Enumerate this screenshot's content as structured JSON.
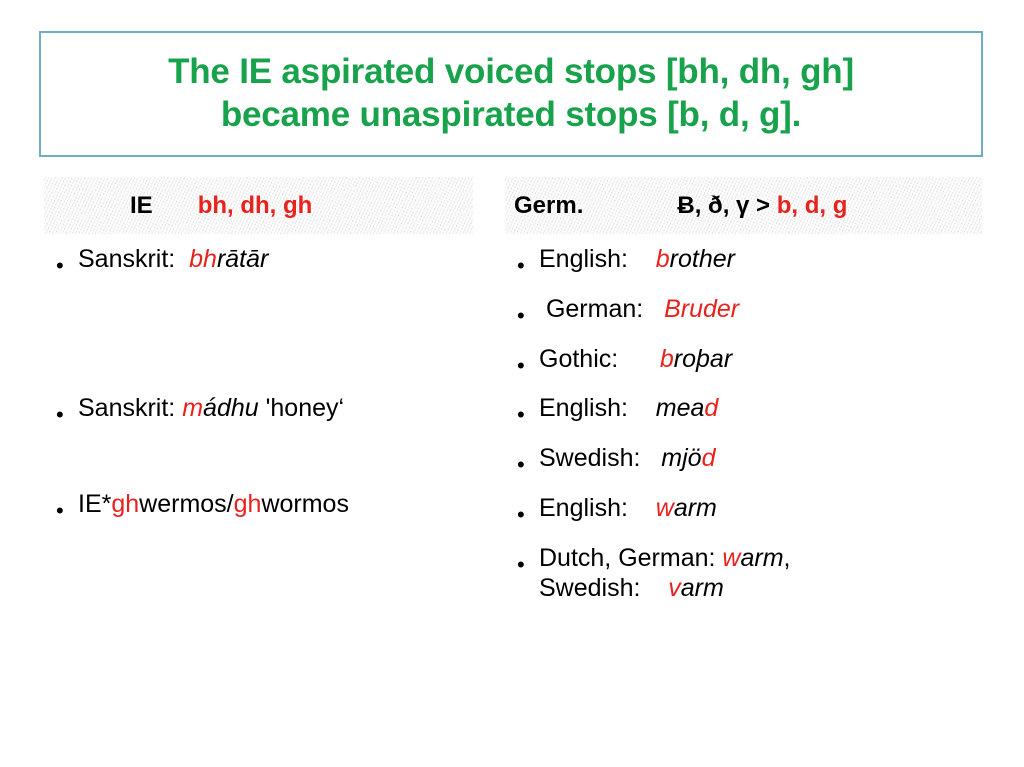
{
  "slide": {
    "title_lines": [
      "The IE aspirated voiced stops [bh, dh, gh]",
      "became unaspirated stops [b, d, g]."
    ],
    "title_color": "#18A24B",
    "title_border_color": "#6FAEC4",
    "accent_red": "#E8221C",
    "band_background": "#ECECEC"
  },
  "left_column": {
    "header": {
      "label": "IE",
      "sounds": "bh, dh, gh"
    },
    "bullet_glyph": "•",
    "items": [
      {
        "language": "Sanskrit:",
        "gap": "\t",
        "word_red": "bh",
        "word_black": "rātār",
        "suffix": ""
      },
      {
        "language": "Sanskrit:",
        "gap": " ",
        "word_red": "m",
        "word_black": "ádhu",
        "suffix": " 'honey‘"
      },
      {
        "language": "IE*",
        "gap": "",
        "word_red": "gh",
        "word_black": "wermos/",
        "word_red2": "gh",
        "word_black2": "wormos",
        "suffix": ""
      }
    ]
  },
  "right_column": {
    "header": {
      "label": "Germ.",
      "sounds_black": "Ƀ, ð, γ > ",
      "sounds_red": "b, d, g"
    },
    "bullet_glyph": "•",
    "items": [
      {
        "language": "English:",
        "gap": "    ",
        "word_red": "b",
        "word_black": "rother"
      },
      {
        "language": " German:",
        "gap": "   ",
        "word_red": "Bruder",
        "word_black": ""
      },
      {
        "language": "Gothic:",
        "gap": "      ",
        "word_red": "b",
        "word_black": "roþar"
      },
      {
        "language": "English:",
        "gap": "    ",
        "word_red": "",
        "word_black": "mea",
        "word_red_tail": "d"
      },
      {
        "language": "Swedish:",
        "gap": "   ",
        "word_red": "",
        "word_black": "mjö",
        "word_red_tail": "d"
      },
      {
        "language": "English:",
        "gap": "    ",
        "word_red": "w",
        "word_black": "arm"
      },
      {
        "language": "Dutch, German: ",
        "gap": "",
        "word_red": "w",
        "word_black": "arm",
        "suffix": ",",
        "line2_language": "Swedish:",
        "line2_gap": "    ",
        "line2_red": "v",
        "line2_black": "arm"
      }
    ]
  }
}
